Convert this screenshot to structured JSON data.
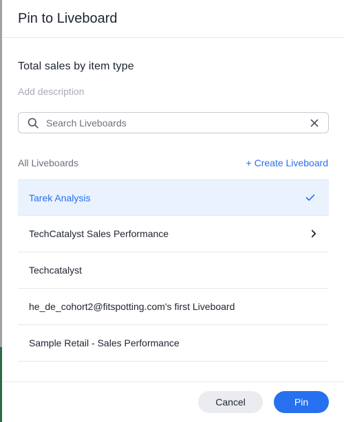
{
  "dialog": {
    "title": "Pin to Liveboard"
  },
  "content": {
    "chart_title": "Total sales by item type",
    "description_placeholder": "Add description"
  },
  "search": {
    "placeholder": "Search Liveboards",
    "value": "",
    "icon": "search-icon",
    "clear_icon": "close-icon"
  },
  "liveboards": {
    "section_label": "All Liveboards",
    "create_label": "+ Create Liveboard",
    "items": [
      {
        "label": "Tarek Analysis",
        "selected": true,
        "trailing_icon": "check-icon"
      },
      {
        "label": "TechCatalyst Sales Performance",
        "selected": false,
        "trailing_icon": "chevron-right-icon"
      },
      {
        "label": "Techcatalyst",
        "selected": false,
        "trailing_icon": ""
      },
      {
        "label": "he_de_cohort2@fitspotting.com's first Liveboard",
        "selected": false,
        "trailing_icon": ""
      },
      {
        "label": "Sample Retail - Sales Performance",
        "selected": false,
        "trailing_icon": ""
      }
    ]
  },
  "footer": {
    "cancel_label": "Cancel",
    "pin_label": "Pin"
  },
  "colors": {
    "accent": "#2770ef",
    "selected_row_bg": "#eaf2fe",
    "text": "#1d232f",
    "muted_text": "#6c717b"
  }
}
